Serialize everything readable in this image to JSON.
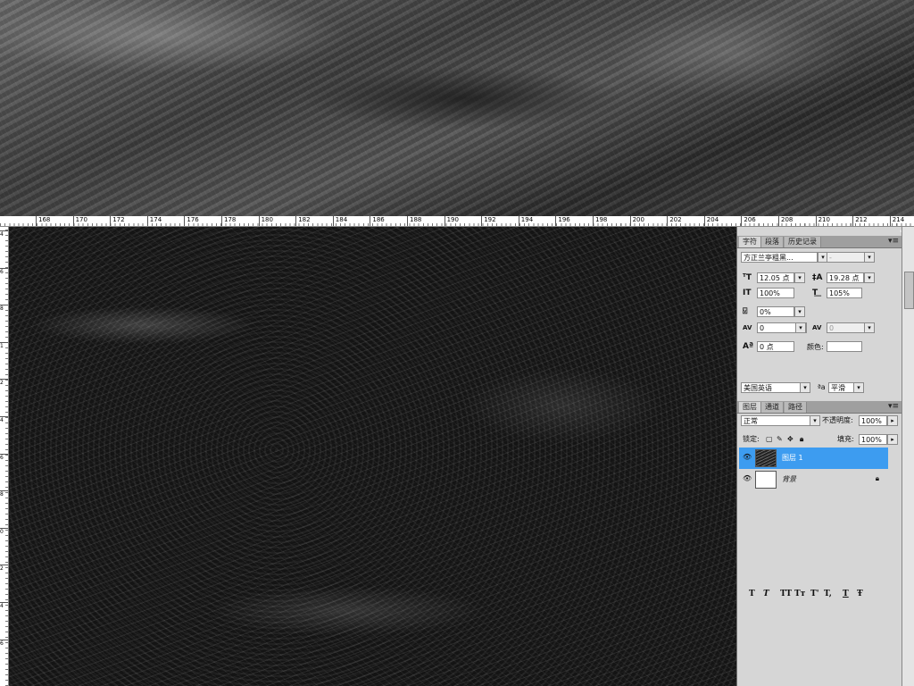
{
  "ruler": {
    "ticks": [
      "168",
      "170",
      "172",
      "174",
      "176",
      "178",
      "180",
      "182",
      "184",
      "186",
      "188",
      "190",
      "192",
      "194",
      "196",
      "198",
      "200",
      "202",
      "204",
      "206",
      "208",
      "210",
      "212",
      "214"
    ],
    "vticks": [
      "4",
      "6",
      "8",
      "1",
      "2",
      "4",
      "6",
      "8",
      "0",
      "2",
      "4",
      "6"
    ]
  },
  "character_panel": {
    "tabs": [
      "字符",
      "段落",
      "历史记录"
    ],
    "font_family": "方正兰亭粗黑...",
    "font_style": "-",
    "font_size": "12.05 点",
    "leading": "19.28 点",
    "vertical_scale": "100%",
    "horizontal_scale": "105%",
    "tsume": "0%",
    "kerning": "0",
    "tracking": "0",
    "baseline_shift": "0 点",
    "color_label": "颜色:",
    "style_buttons": [
      "T",
      "T",
      "TT",
      "Tт",
      "T'",
      "T,",
      "T",
      "Ŧ"
    ],
    "language": "美国英语",
    "aa_label": "ªa",
    "anti_alias": "平滑"
  },
  "layers_panel": {
    "tabs": [
      "图层",
      "通道",
      "路径"
    ],
    "blend_mode": "正常",
    "opacity_label": "不透明度:",
    "opacity": "100%",
    "lock_label": "锁定:",
    "fill_label": "填充:",
    "fill": "100%",
    "layers": [
      {
        "name": "图层 1",
        "selected": true
      },
      {
        "name": "背景",
        "selected": false
      }
    ]
  }
}
